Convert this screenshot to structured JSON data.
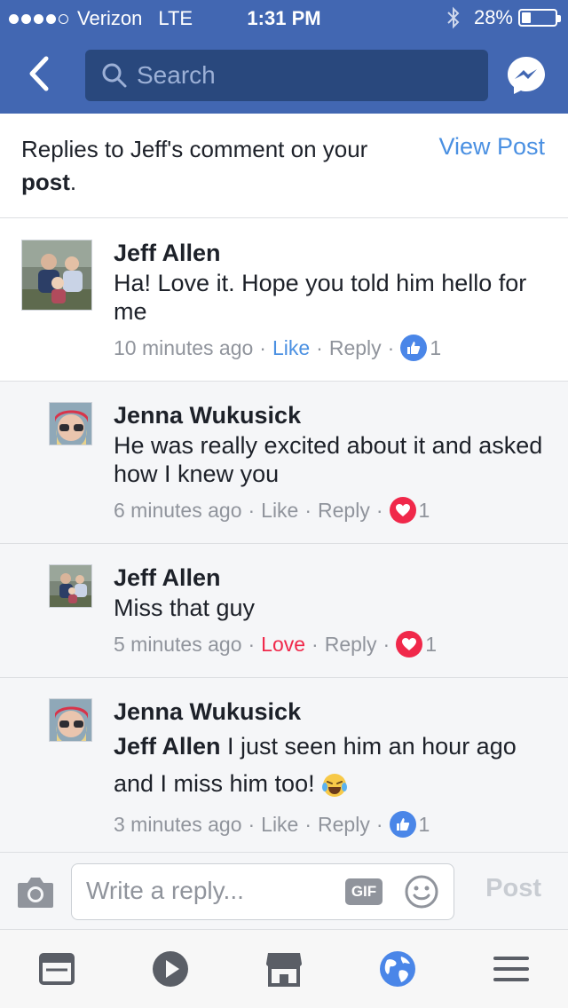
{
  "status_bar": {
    "carrier": "Verizon",
    "network": "LTE",
    "time": "1:31 PM",
    "battery": "28%"
  },
  "nav": {
    "search_placeholder": "Search",
    "back_icon": "back-arrow-icon",
    "messenger_icon": "messenger-icon"
  },
  "header": {
    "text_prefix": "Replies to Jeff's comment on your ",
    "text_bold": "post",
    "text_suffix": ".",
    "view_post": "View Post"
  },
  "comments": [
    {
      "name": "Jeff Allen",
      "text": "Ha! Love it. Hope you told him hello for me",
      "time": "10 minutes ago",
      "action": "Like",
      "reply": "Reply",
      "reaction": "like",
      "reaction_count": "1"
    },
    {
      "name": "Jenna Wukusick",
      "text": "He was really excited about it and asked how I knew you",
      "time": "6 minutes ago",
      "action": "Like",
      "reply": "Reply",
      "reaction": "love",
      "reaction_count": "1"
    },
    {
      "name": "Jeff Allen",
      "text": "Miss that guy",
      "time": "5 minutes ago",
      "action": "Love",
      "reply": "Reply",
      "reaction": "love",
      "reaction_count": "1"
    },
    {
      "name": "Jenna Wukusick",
      "mention": "Jeff Allen",
      "text": " I just seen him an hour ago and I miss him too! ",
      "time": "3 minutes ago",
      "action": "Like",
      "reply": "Reply",
      "reaction": "like",
      "reaction_count": "1"
    }
  ],
  "composer": {
    "placeholder": "Write a reply...",
    "gif_label": "GIF",
    "post_label": "Post"
  },
  "tabs": [
    {
      "icon": "news-feed-icon"
    },
    {
      "icon": "video-play-icon"
    },
    {
      "icon": "marketplace-icon"
    },
    {
      "icon": "globe-notifications-icon"
    },
    {
      "icon": "menu-icon"
    }
  ],
  "colors": {
    "brand": "#4267b2",
    "search_bg": "#29487d",
    "link": "#4a90e2",
    "love": "#f0284a",
    "like": "#4a86e8",
    "meta_text": "#90949c",
    "reply_bg": "#f5f6f8"
  }
}
